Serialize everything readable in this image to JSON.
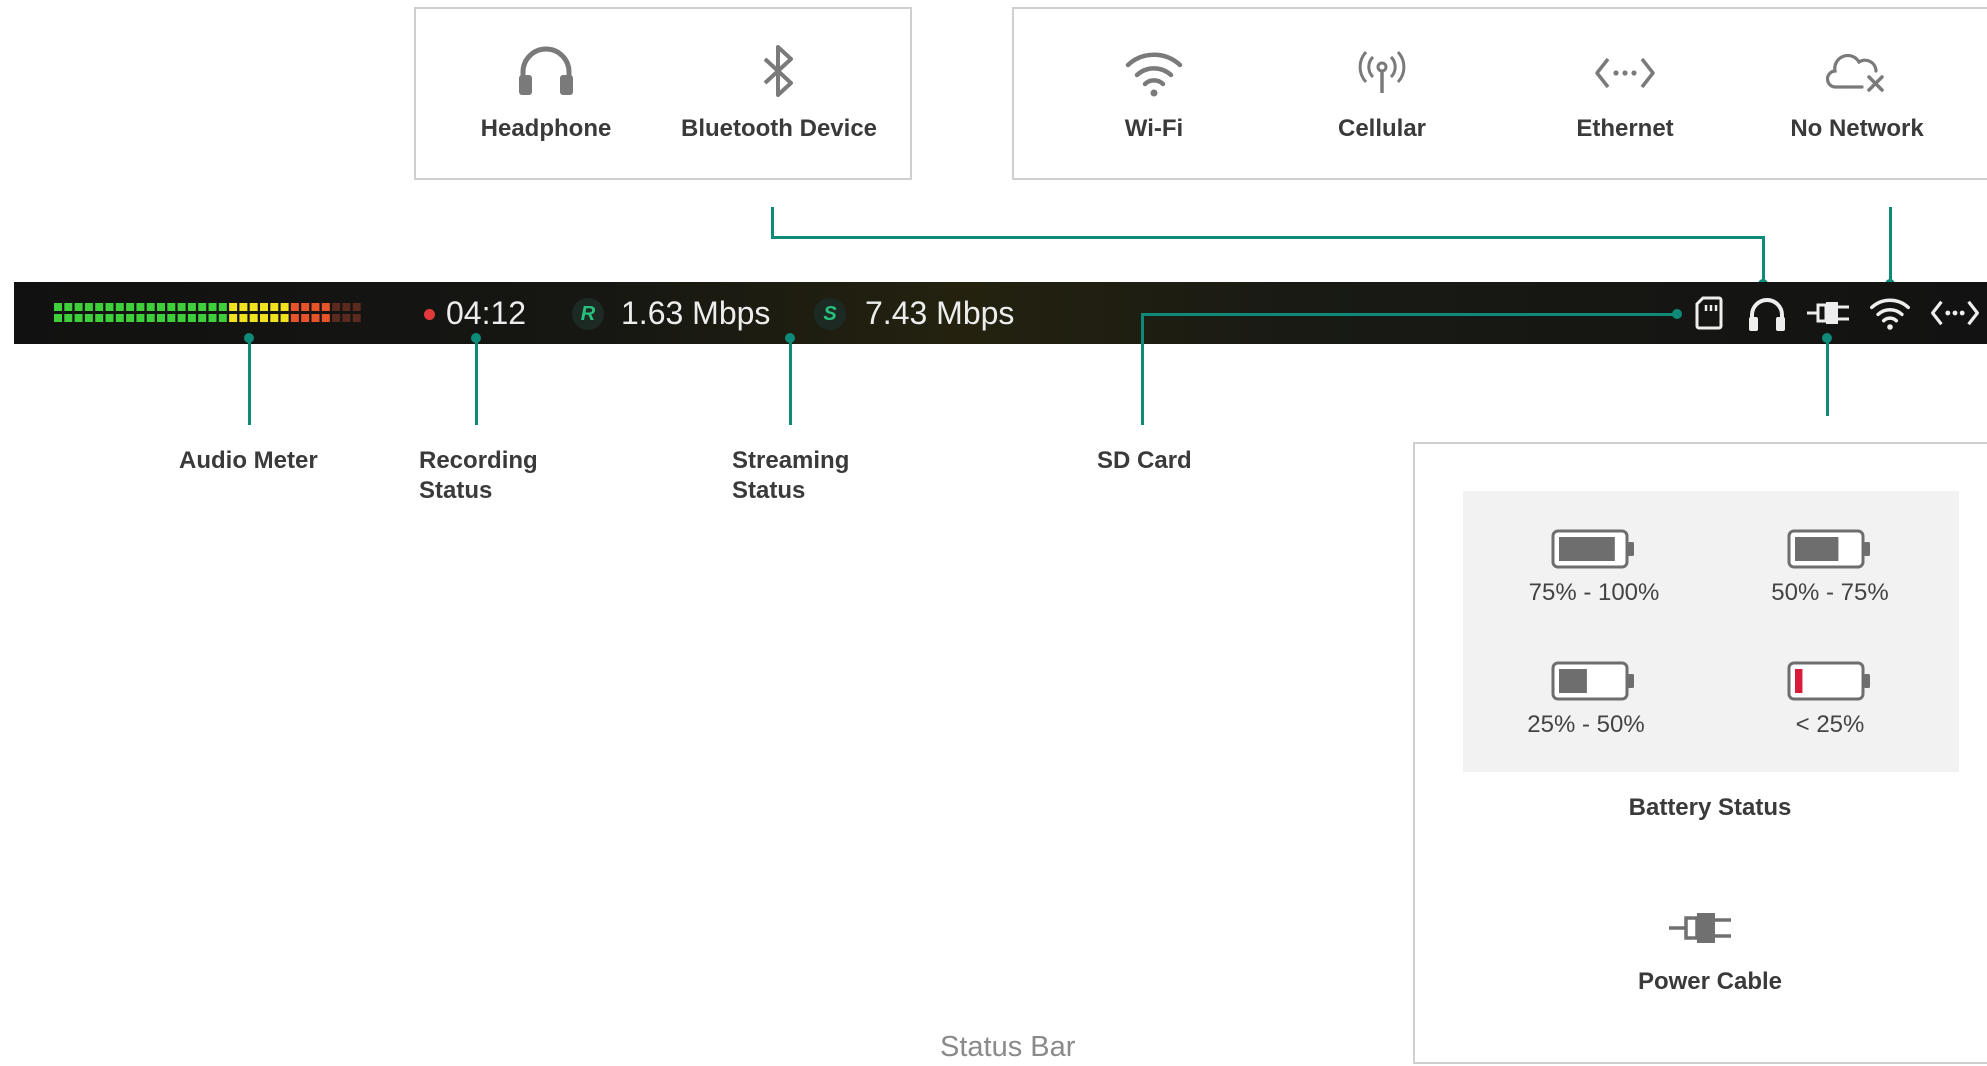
{
  "audio_devices": {
    "items": [
      {
        "label": "Headphone",
        "icon": "headphone-icon"
      },
      {
        "label": "Bluetooth Device",
        "icon": "bluetooth-icon"
      }
    ]
  },
  "network_types": {
    "items": [
      {
        "label": "Wi-Fi",
        "icon": "wifi-icon"
      },
      {
        "label": "Cellular",
        "icon": "cellular-icon"
      },
      {
        "label": "Ethernet",
        "icon": "ethernet-icon"
      },
      {
        "label": "No Network",
        "icon": "no-network-icon"
      }
    ]
  },
  "status_bar": {
    "recording_time": "04:12",
    "recording_badge": "R",
    "recording_bitrate": "1.63 Mbps",
    "streaming_badge": "S",
    "streaming_bitrate": "7.43 Mbps",
    "icons": [
      "sd-card-icon",
      "headphone-icon",
      "power-plug-icon",
      "wifi-icon",
      "ethernet-icon"
    ]
  },
  "callouts": {
    "audio_meter": "Audio Meter",
    "recording_status": [
      "Recording",
      "Status"
    ],
    "streaming_status": [
      "Streaming",
      "Status"
    ],
    "sd_card": "SD Card"
  },
  "battery": {
    "levels": [
      {
        "label": "75% - 100%",
        "fill": 0.9
      },
      {
        "label": "50% - 75%",
        "fill": 0.7
      },
      {
        "label": "25% - 50%",
        "fill": 0.45
      },
      {
        "label": "< 25%",
        "fill": 0.12
      }
    ],
    "title": "Battery Status"
  },
  "power": {
    "label": "Power Cable",
    "icon": "power-plug-icon"
  },
  "caption": "Status Bar",
  "colors": {
    "accent": "#0e8a78",
    "meter_green": "#3fcf3a",
    "meter_yellow": "#f0e21e",
    "meter_red": "#e8542a",
    "record_red": "#e23a3a",
    "battery_low": "#d81b3a"
  }
}
